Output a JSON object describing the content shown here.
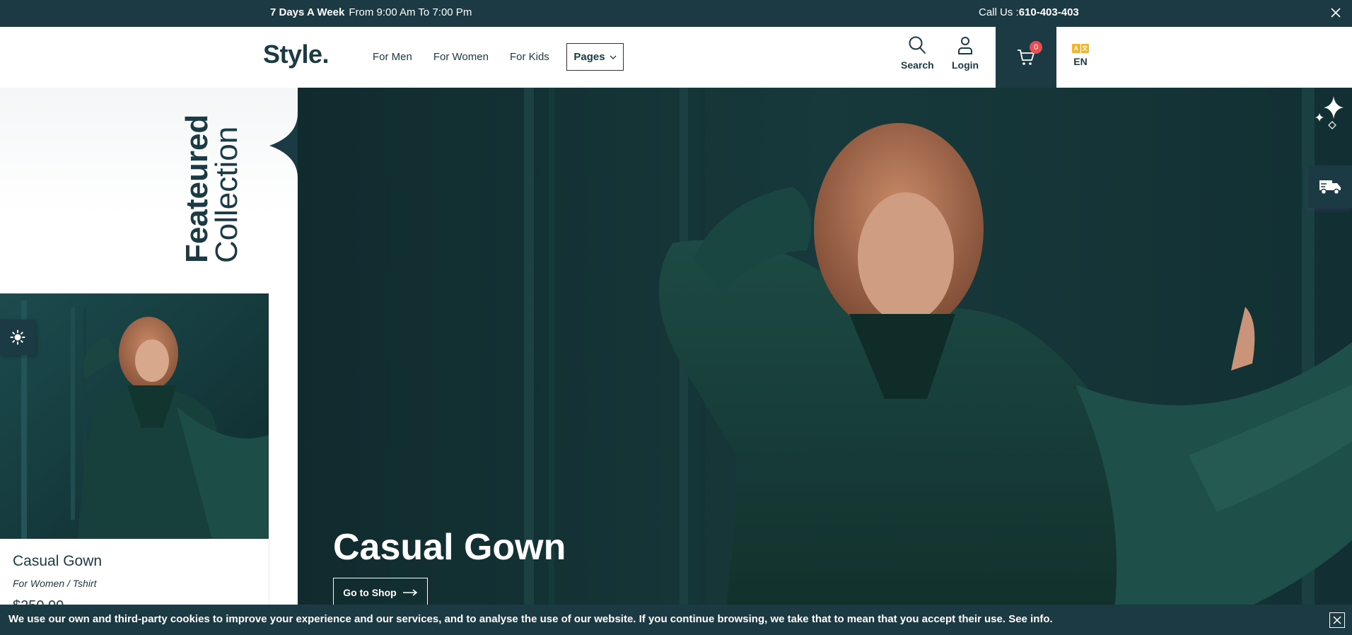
{
  "topbar": {
    "hours_bold": "7 Days A Week",
    "hours_text": "From 9:00 Am To 7:00 Pm",
    "call_label": "Call Us :",
    "call_number": "610-403-403"
  },
  "header": {
    "logo": "Style.",
    "nav": [
      "For Men",
      "For Women",
      "For Kids"
    ],
    "pages_label": "Pages",
    "search_label": "Search",
    "login_label": "Login",
    "cart_count": "0",
    "lang_label": "EN"
  },
  "featured": {
    "title_bold": "Feateured",
    "title_light": "Collection",
    "card": {
      "name": "Casual Gown",
      "category": "For Women / Tshirt",
      "price": "$250.00"
    }
  },
  "hero": {
    "title": "Casual Gown",
    "button_label": "Go to Shop"
  },
  "cookie": {
    "text": "We use our own and third-party cookies to improve your experience and our services, and to analyse the use of our website. If you continue browsing, we take that to mean that you accept their use. See info."
  },
  "colors": {
    "primary": "#1b3a44",
    "badge": "#e94e55",
    "lang_icon": "#f2b530"
  }
}
